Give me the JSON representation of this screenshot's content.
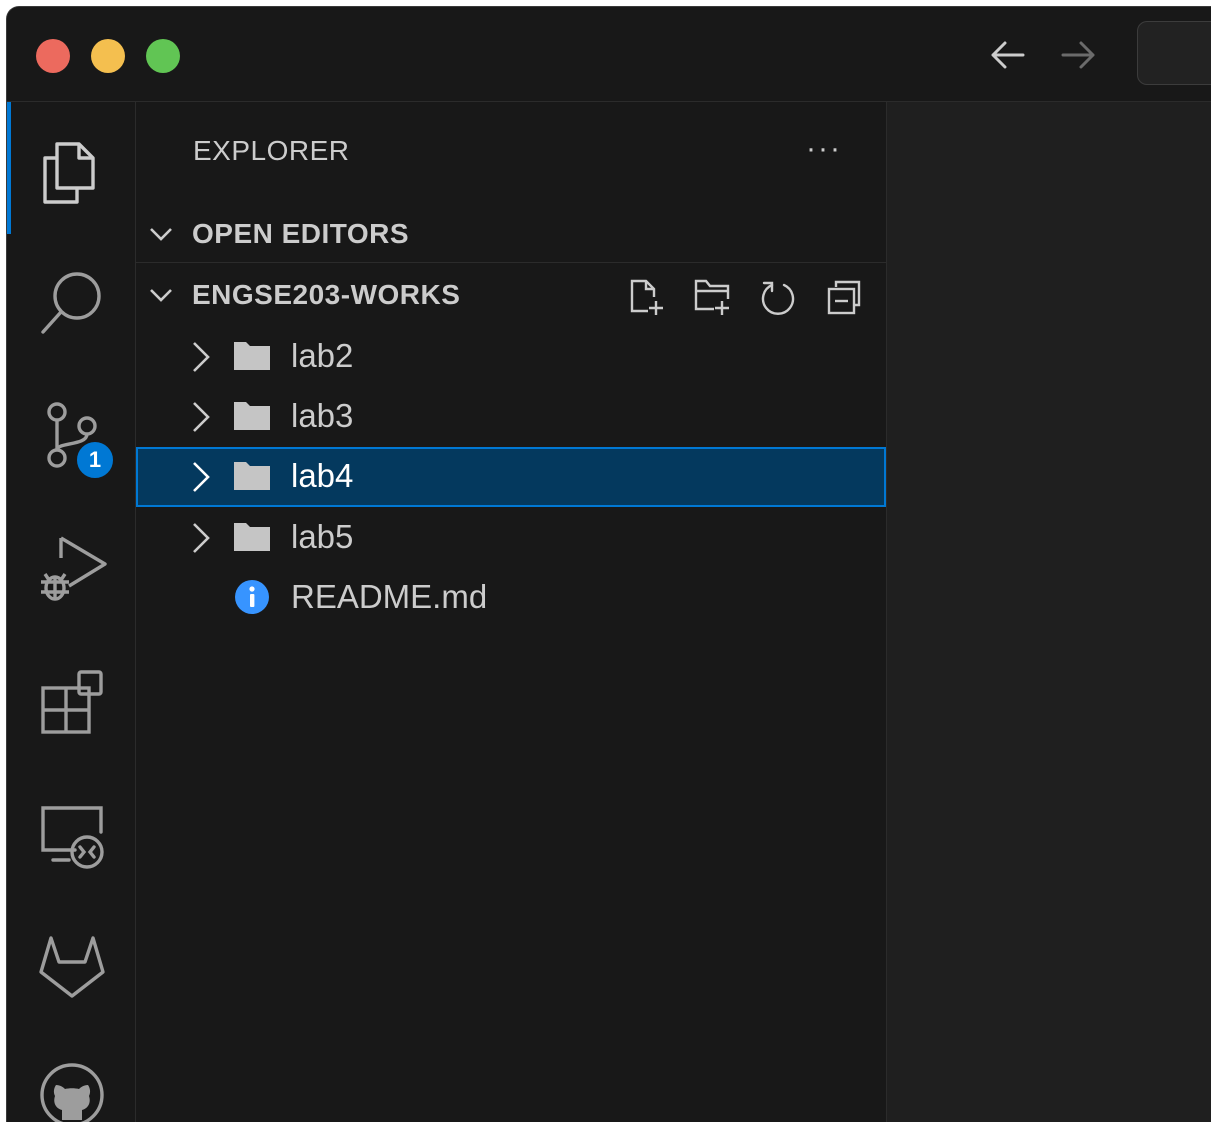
{
  "sidebar": {
    "title": "EXPLORER",
    "more_actions": "···",
    "sections": {
      "open_editors": "OPEN EDITORS",
      "workspace": "ENGSE203-WORKS"
    },
    "workspace_actions": [
      "new-file-icon",
      "new-folder-icon",
      "refresh-icon",
      "collapse-all-icon"
    ],
    "tree": [
      {
        "label": "lab2",
        "type": "folder",
        "expanded": false,
        "selected": false
      },
      {
        "label": "lab3",
        "type": "folder",
        "expanded": false,
        "selected": false
      },
      {
        "label": "lab4",
        "type": "folder",
        "expanded": false,
        "selected": true
      },
      {
        "label": "lab5",
        "type": "folder",
        "expanded": false,
        "selected": false
      },
      {
        "label": "README.md",
        "type": "info-file",
        "selected": false
      }
    ]
  },
  "activity_bar": {
    "items": [
      "explorer-icon",
      "search-icon",
      "source-control-icon",
      "run-debug-icon",
      "extensions-icon",
      "remote-explorer-icon",
      "gitlab-icon",
      "github-icon"
    ],
    "active": "explorer-icon",
    "source_control_badge": "1"
  },
  "colors": {
    "background": "#181818",
    "editor": "#1f1f1f",
    "accent": "#0078d4",
    "selection": "#04395e",
    "text": "#cccccc",
    "folder": "#c5c5c5",
    "info": "#3794ff",
    "close": "#ec6a5e",
    "minimize": "#f4bf4f",
    "maximize": "#61c554"
  }
}
